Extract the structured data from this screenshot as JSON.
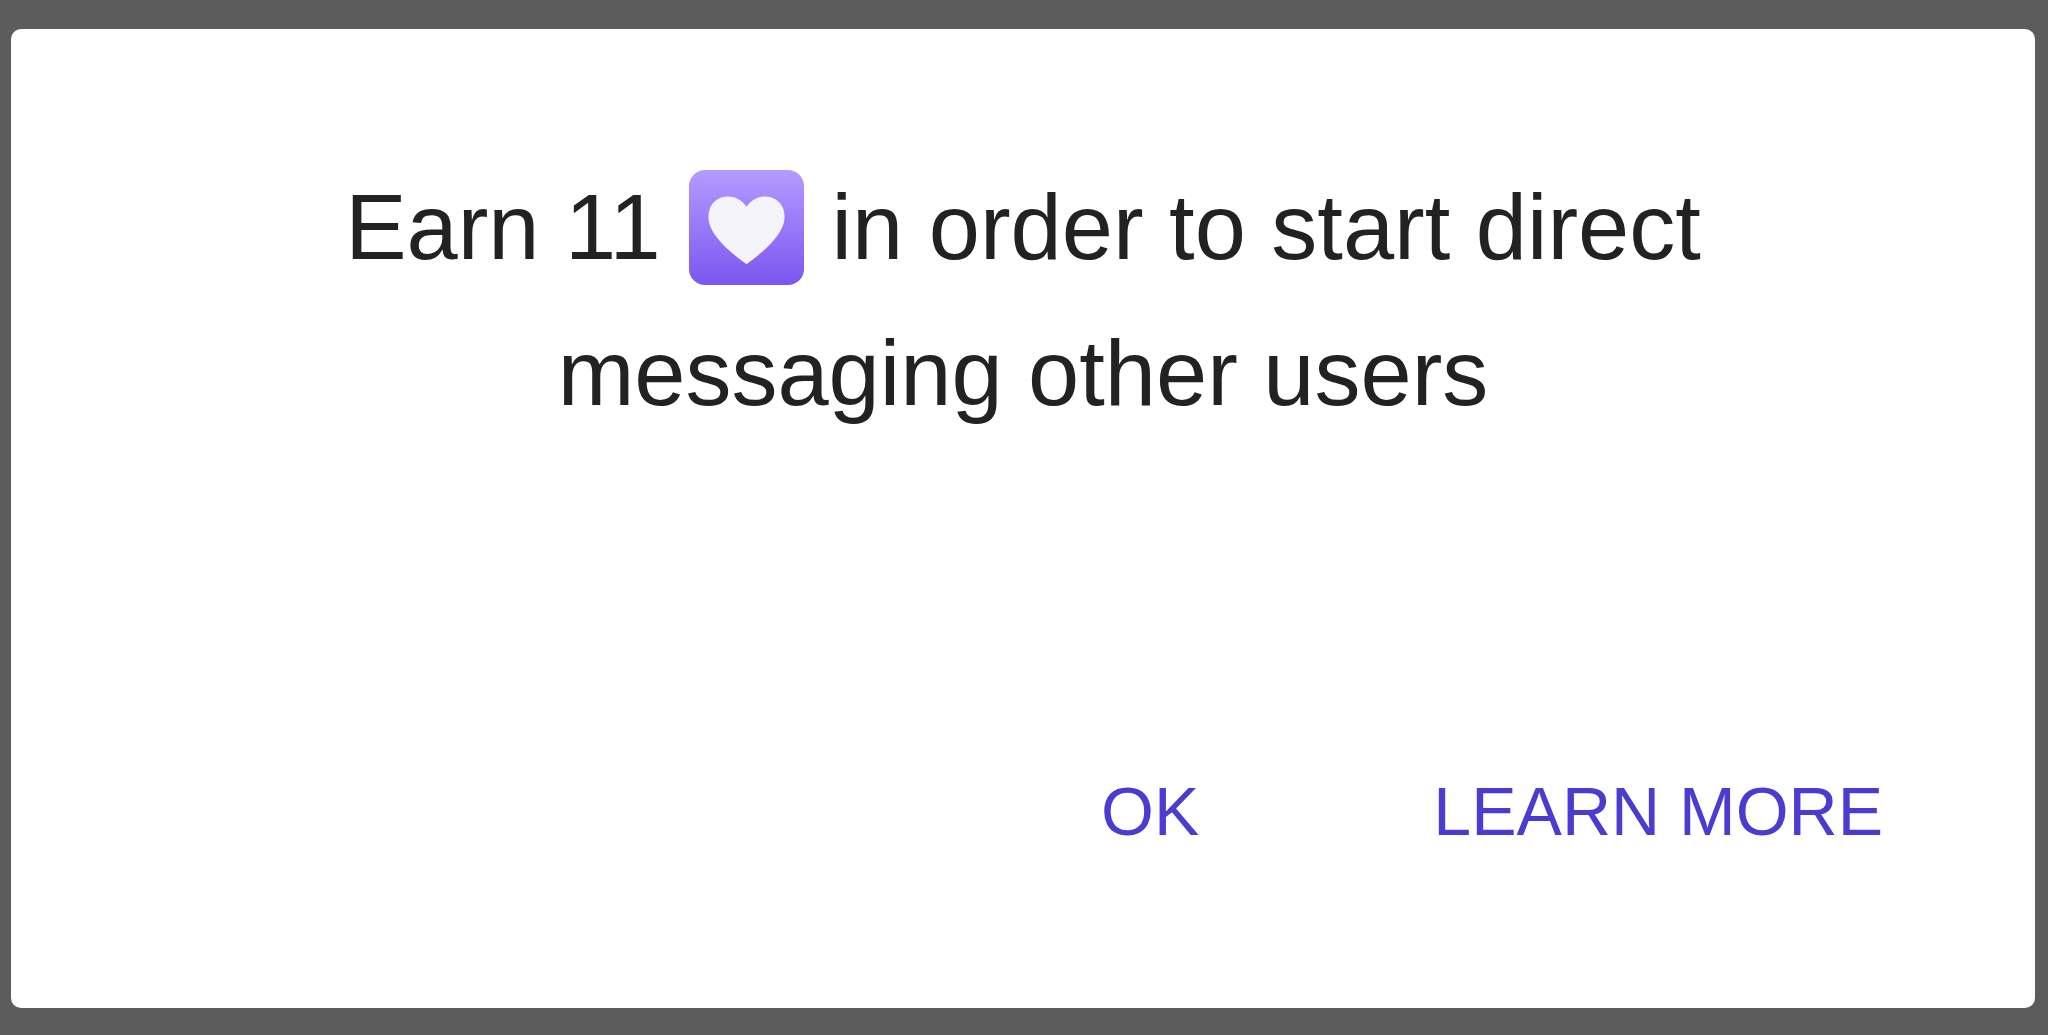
{
  "dialog": {
    "message_before_icon": "Earn 11",
    "message_after_icon": "in order to start direct",
    "message_second_line": "messaging other users",
    "buttons": [
      {
        "label": "OK"
      },
      {
        "label": "LEARN MORE"
      }
    ]
  }
}
